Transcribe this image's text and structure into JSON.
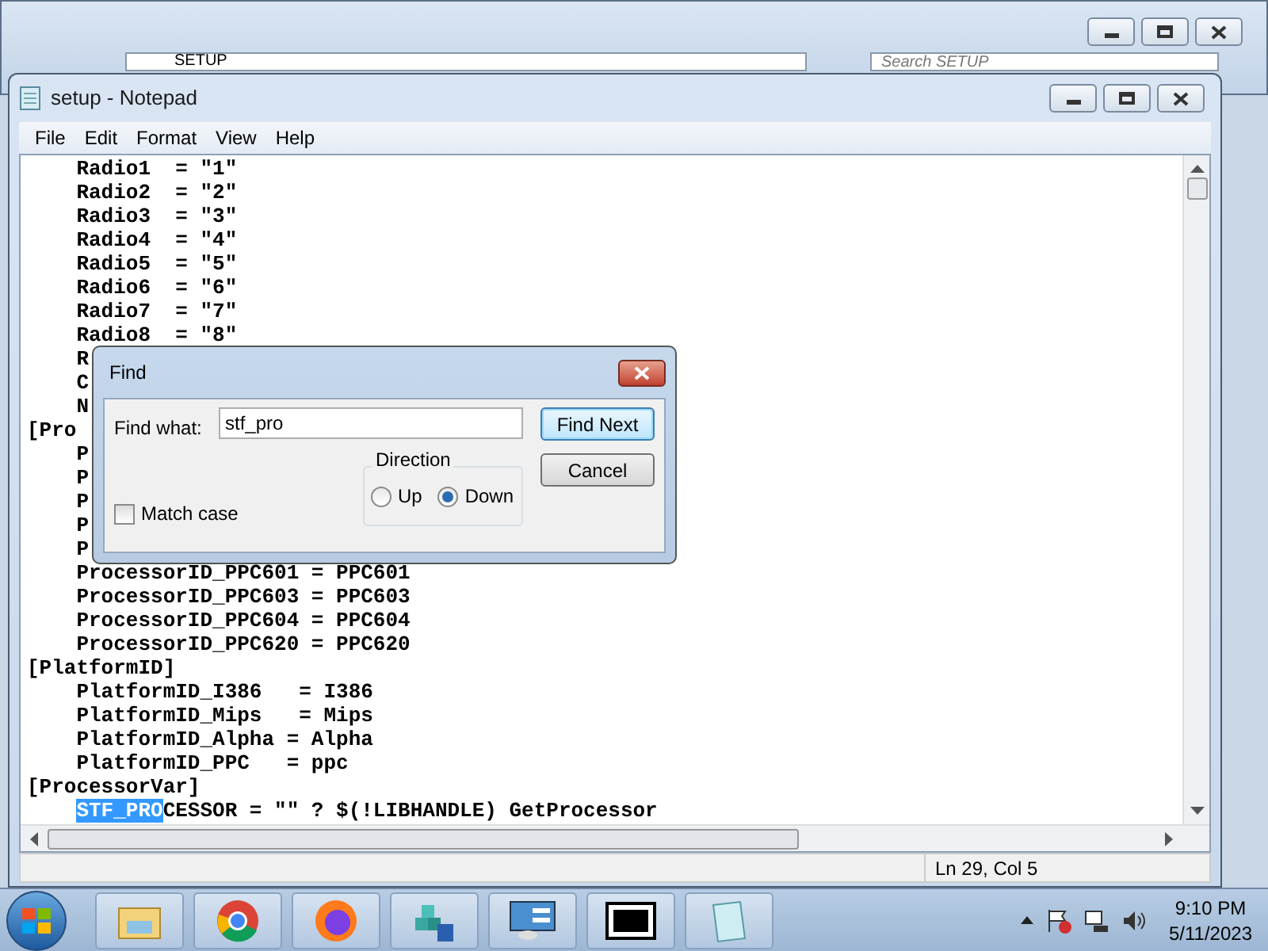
{
  "background_window": {
    "address": "SETUP",
    "search": {
      "placeholder": "Search SETUP"
    }
  },
  "window": {
    "title": "setup - Notepad"
  },
  "menu": [
    "File",
    "Edit",
    "Format",
    "View",
    "Help"
  ],
  "lines": [
    {
      "text": "    Radio1  = \"1\""
    },
    {
      "text": "    Radio2  = \"2\""
    },
    {
      "text": "    Radio3  = \"3\""
    },
    {
      "text": "    Radio4  = \"4\""
    },
    {
      "text": "    Radio5  = \"5\""
    },
    {
      "text": "    Radio6  = \"6\""
    },
    {
      "text": "    Radio7  = \"7\""
    },
    {
      "text": "    Radio8  = \"8\""
    },
    {
      "text": "    R"
    },
    {
      "text": "    C"
    },
    {
      "text": "    N"
    },
    {
      "text": "[Pro"
    },
    {
      "text": "    P"
    },
    {
      "text": "    P"
    },
    {
      "text": "    P"
    },
    {
      "text": "    P"
    },
    {
      "text": "    P"
    },
    {
      "text": "    ProcessorID_PPC601 = PPC601"
    },
    {
      "text": "    ProcessorID_PPC603 = PPC603"
    },
    {
      "text": "    ProcessorID_PPC604 = PPC604"
    },
    {
      "text": "    ProcessorID_PPC620 = PPC620"
    },
    {
      "text": "[PlatformID]"
    },
    {
      "text": "    PlatformID_I386   = I386"
    },
    {
      "text": "    PlatformID_Mips   = Mips"
    },
    {
      "text": "    PlatformID_Alpha = Alpha"
    },
    {
      "text": "    PlatformID_PPC   = ppc"
    },
    {
      "text": "[ProcessorVar]"
    },
    {
      "text": "CESSOR = \"\" ? $(!LIBHANDLE) GetProcessor",
      "selected": "STF_PRO"
    }
  ],
  "find_dialog": {
    "title": "Find",
    "find_what_label": "Find what:",
    "find_what_value": "stf_pro",
    "find_next": "Find Next",
    "cancel": "Cancel",
    "direction_label": "Direction",
    "directions": [
      {
        "label": "Up",
        "selected": false
      },
      {
        "label": "Down",
        "selected": true
      }
    ],
    "match_case": {
      "label": "Match case",
      "checked": false
    }
  },
  "status_bar": "Ln 29, Col 5",
  "taskbar": {
    "time": "9:10 PM",
    "date": "5/11/2023"
  }
}
